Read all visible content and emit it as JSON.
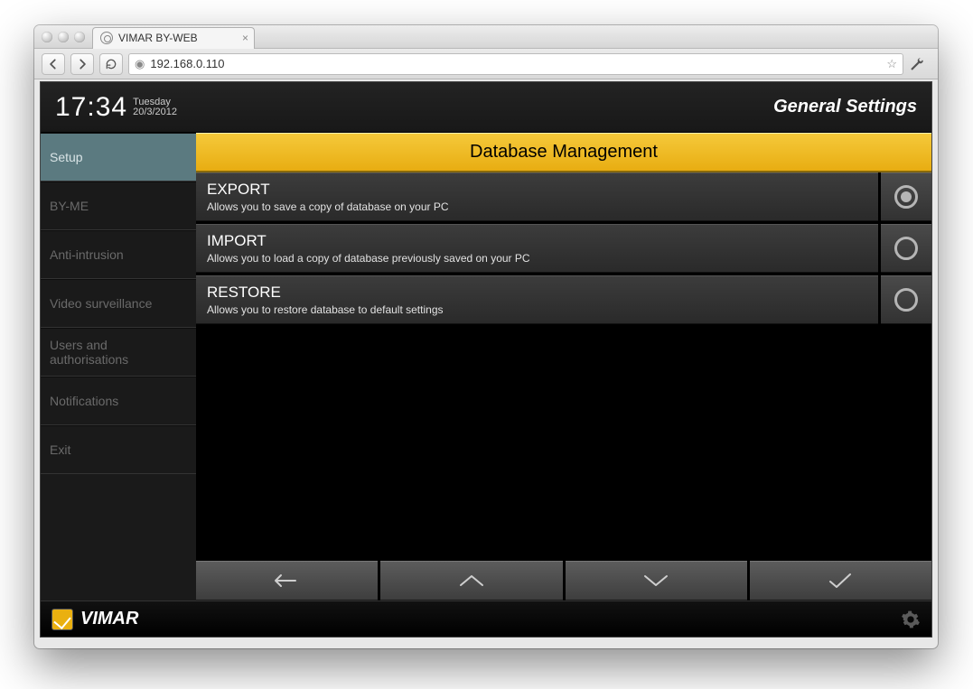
{
  "browser": {
    "tab_title": "VIMAR BY-WEB",
    "url": "192.168.0.110"
  },
  "header": {
    "time": "17:34",
    "day": "Tuesday",
    "date": "20/3/2012",
    "title": "General Settings"
  },
  "sidebar": {
    "items": [
      {
        "label": "Setup",
        "active": true
      },
      {
        "label": "BY-ME",
        "active": false
      },
      {
        "label": "Anti-intrusion",
        "active": false
      },
      {
        "label": "Video surveillance",
        "active": false
      },
      {
        "label": "Users and authorisations",
        "active": false
      },
      {
        "label": "Notifications",
        "active": false
      },
      {
        "label": "Exit",
        "active": false
      }
    ]
  },
  "panel": {
    "title": "Database Management",
    "options": [
      {
        "title": "EXPORT",
        "desc": "Allows you to save a copy of database on your PC",
        "selected": true
      },
      {
        "title": "IMPORT",
        "desc": "Allows you to load a copy of database previously saved on your PC",
        "selected": false
      },
      {
        "title": "RESTORE",
        "desc": "Allows you to restore database to default settings",
        "selected": false
      }
    ]
  },
  "footer": {
    "brand": "VIMAR"
  }
}
